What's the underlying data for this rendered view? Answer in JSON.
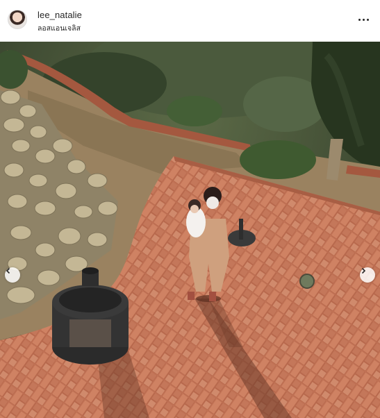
{
  "post": {
    "username": "lee_natalie",
    "location": "ลอสแอนเจลิส",
    "more_icon": "more-horizontal-icon"
  },
  "carousel": {
    "prev_icon": "chevron-left-icon",
    "next_icon": "chevron-right-icon"
  },
  "colors": {
    "brick": "#c97a5c",
    "brick_dark": "#a85e44",
    "foliage": "#3d4b33",
    "text": "#262626"
  }
}
